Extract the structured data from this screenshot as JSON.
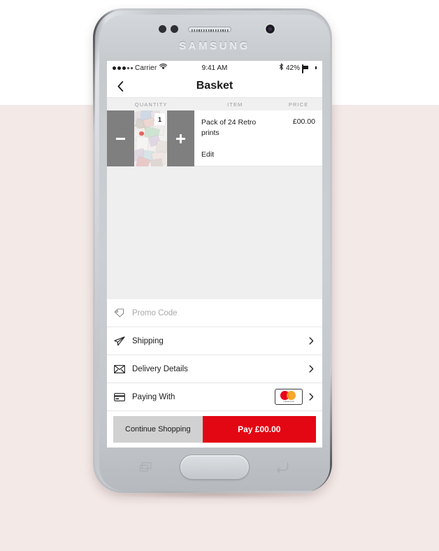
{
  "device": {
    "brand": "SAMSUNG",
    "sensor_left_icon": "proximity-sensor",
    "sensor_right_icon": "light-sensor",
    "earpiece_icon": "earpiece-speaker",
    "camera_icon": "front-camera",
    "home_button_label": "",
    "recents_icon": "recents-icon",
    "back_nav_icon": "back-nav-icon"
  },
  "status_bar": {
    "carrier": "Carrier",
    "signal_icon": "signal-dots",
    "wifi_icon": "wifi-icon",
    "time": "9:41 AM",
    "bluetooth_icon": "bluetooth-icon",
    "battery_percent": "42%",
    "battery_icon": "battery-icon"
  },
  "nav": {
    "back_icon": "chevron-left-icon",
    "title": "Basket"
  },
  "table": {
    "headers": {
      "quantity": "QUANTITY",
      "item": "ITEM",
      "price": "PRICE"
    }
  },
  "cart_item": {
    "decrease_label": "−",
    "decrease_icon": "minus-icon",
    "increase_label": "+",
    "increase_icon": "plus-icon",
    "quantity": "1",
    "thumbnail_icon": "product-photo-collage",
    "name": "Pack of 24 Retro prints",
    "edit_label": "Edit",
    "price": "£00.00"
  },
  "options": [
    {
      "id": "promo-code",
      "icon": "tag-icon",
      "label": "Promo Code",
      "is_placeholder": true,
      "has_chevron": false,
      "has_card_badge": false
    },
    {
      "id": "shipping",
      "icon": "paper-plane-icon",
      "label": "Shipping",
      "is_placeholder": false,
      "has_chevron": true,
      "has_card_badge": false
    },
    {
      "id": "delivery-details",
      "icon": "envelope-icon",
      "label": "Delivery Details",
      "is_placeholder": false,
      "has_chevron": true,
      "has_card_badge": false
    },
    {
      "id": "paying-with",
      "icon": "credit-card-icon",
      "label": "Paying With",
      "is_placeholder": false,
      "has_chevron": true,
      "has_card_badge": true,
      "card_brand": "mastercard",
      "card_brand_word": "mastercard"
    }
  ],
  "actions": {
    "continue_label": "Continue Shopping",
    "pay_label": "Pay £00.00"
  },
  "colors": {
    "accent_red": "#e30613",
    "page_pink": "#f3e9e7",
    "stepper_gray": "#7f7f7f",
    "filler_gray": "#efefef",
    "mastercard_red": "#eb001b",
    "mastercard_yellow": "#f79e1b"
  }
}
